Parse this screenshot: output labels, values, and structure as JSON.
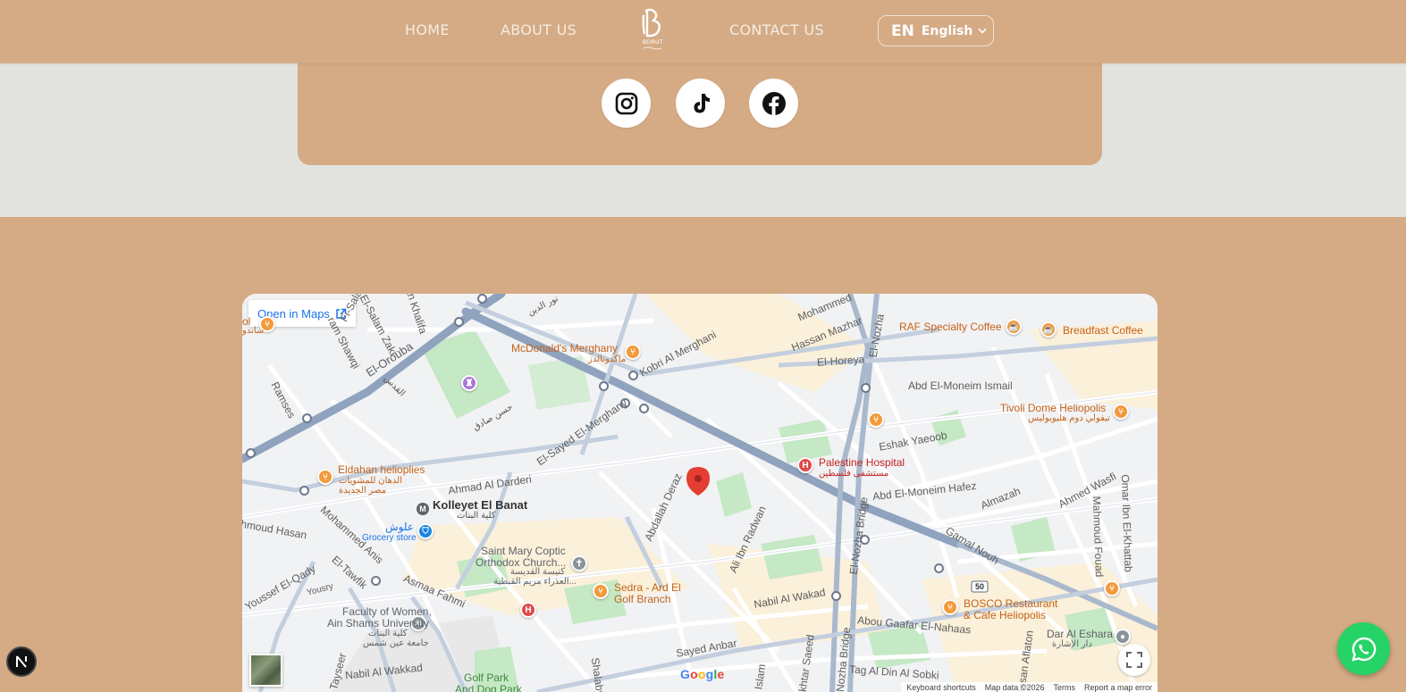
{
  "nav": {
    "home": "HOME",
    "about": "ABOUT US",
    "contact": "CONTACT US",
    "logo_text": "BEIRUT",
    "lang_code": "EN",
    "lang_name": "English"
  },
  "social": [
    {
      "name": "instagram-icon"
    },
    {
      "name": "tiktok-icon"
    },
    {
      "name": "facebook-icon"
    }
  ],
  "map": {
    "open_in_maps": "Open in Maps",
    "google": "Google",
    "attribution": {
      "shortcuts": "Keyboard shortcuts",
      "data": "Map data ©2026",
      "terms": "Terms",
      "report": "Report a map error"
    },
    "labels": {
      "mcdonalds": "McDonald's Merghany",
      "mcdonalds_ar": "ماكدونالدز",
      "raf": "RAF Specialty Coffee",
      "breadfast": "Breadfast Coffee",
      "tivoli": "Tivoli Dome Heliopolis",
      "tivoli_ar": "تيفولي دوم هليوبوليس",
      "eldahan": "Eldahan helioplies",
      "eldahan_ar1": "الدهان للمشويات",
      "eldahan_ar2": "مصر الجديدة",
      "kolleyet": "Kolleyet El Banat",
      "kolleyet_ar": "كلية البنات",
      "oloush_ar": "علوش",
      "grocery": "Grocery store",
      "palestine": "Palestine Hospital",
      "palestine_ar": "مستشفى فلسطين",
      "stmary1": "Saint Mary Coptic",
      "stmary2": "Orthodox Church...",
      "stmary_ar1": "كنيسة القديسة",
      "stmary_ar2": "العذراء مريم القبطية...",
      "sedra1": "Sedra - Ard El",
      "sedra2": "Golf Branch",
      "bosco1": "BOSCO Restaurant",
      "bosco2": "& Cafe Heliopolis",
      "faculty1": "Faculty of Women,",
      "faculty2": "Ain Shams University",
      "faculty_ar1": "كلية البنات",
      "faculty_ar2": "جامعة عين شمس",
      "golf1": "Golf Park",
      "golf2": "And Dog Park",
      "dar": "Dar Al Eshara",
      "dar_ar": "دار الإشارة",
      "elorouba": "El-Oroubа",
      "elmerghany": "El-Sayed El-Merghany",
      "kobri": "Kobri Al Merghani",
      "elhoreya": "El-Horeya",
      "elnozha": "El-Nozha",
      "elnozha_bridge": "El-Nozha Bridge",
      "elnozha_bridge2": "El-Nozha Bridge",
      "abdelmoneim": "Abd El-Moneim Ismail",
      "abdelmoneim_hafez": "Abd El-Moneim Hafez",
      "eshak": "Eshak Yaeoob",
      "almazah": "Almazah",
      "ahmedwasfi": "Ahmed Wasfi",
      "mahmoudfouad": "Mahmoud Fouad",
      "omaribn": "Omar Ibn El-Khattab",
      "gamal": "Gamal Nouh",
      "nabil": "Nabil Al Wakad",
      "nabil2": "Nabil Al Wakkad",
      "abougaafar": "Abou Gaafar El-Nahaas",
      "tagaldin": "Tag Al Din Al Sobki",
      "sayedanbar": "Sayed Anbar",
      "aliibn": "Ali Ibn Radwan",
      "abdallah": "Abdallah Deraz",
      "ahmedaldarderi": "Ahmad Al Darderi",
      "asmaa": "Asmaa Fahmi",
      "elyousry": "Yousry",
      "eltawfik": "El-Tawfik",
      "mohammedanis": "Mohammed Anis",
      "youssef": "Youssef El-Qady",
      "mahmoud_hasan": "hmoud Hasan",
      "ramses": "Ramses",
      "ram_shawqi": "ram Shawqi",
      "elsalam": "El-Salam Zaki",
      "khalifa": "an Khalifa",
      "hassan": "Hassan Mazhar",
      "mohammed_top": "Mohammed",
      "tayseer": "Tayseer",
      "shalaby": "Shalaby",
      "islam": "Islam",
      "mokhtar": "ukhtar Saeed",
      "hassan_aflaton": "Hassan Aflaton",
      "hosny_ar": "حسن صادق",
      "elqods_ar": "القدس",
      "nour_ar": "نور الدين",
      "left_ar": "ساندو",
      "left_ol": "ol",
      "fi_salam": "Fi-Salam",
      "route_50": "50",
      "m": "M"
    }
  },
  "colors": {
    "nav_bg": "#d4ab85",
    "page_bg": "#e2e3df",
    "whatsapp": "#25d366",
    "link": "#1a73e8"
  }
}
